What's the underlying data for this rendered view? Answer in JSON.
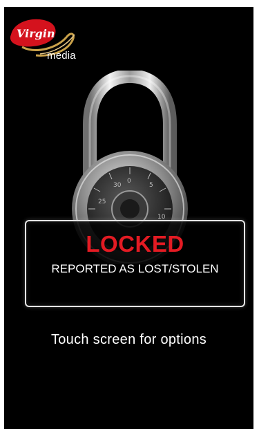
{
  "brand": {
    "logo_script": "Virgin",
    "logo_word": "media",
    "accent_color": "#e31b23"
  },
  "lock_screen": {
    "status_title": "LOCKED",
    "status_subtitle": "REPORTED AS LOST/STOLEN",
    "prompt": "Touch screen for options"
  },
  "icons": {
    "padlock": "padlock-icon"
  }
}
